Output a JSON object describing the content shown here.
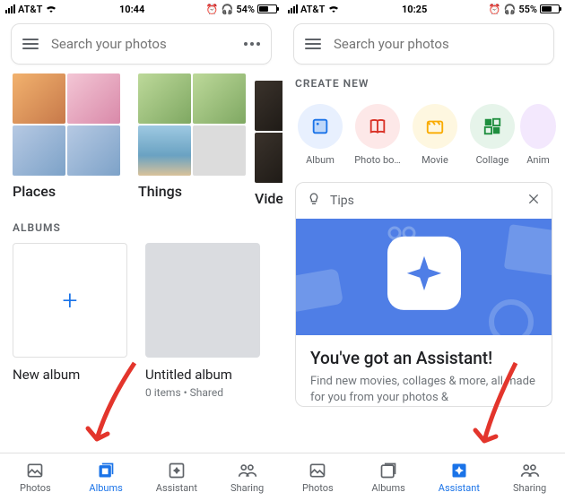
{
  "left": {
    "status": {
      "carrier": "AT&T",
      "time": "10:44",
      "battery_pct": "54%"
    },
    "search": {
      "placeholder": "Search your photos"
    },
    "categories": [
      {
        "label": "Places"
      },
      {
        "label": "Things"
      },
      {
        "label": "Videos"
      }
    ],
    "albums_header": "ALBUMS",
    "albums": [
      {
        "title": "New album",
        "sub": ""
      },
      {
        "title": "Untitled album",
        "sub": "0 items  •  Shared"
      }
    ],
    "nav": {
      "photos": "Photos",
      "albums": "Albums",
      "assistant": "Assistant",
      "sharing": "Sharing",
      "active": "albums"
    }
  },
  "right": {
    "status": {
      "carrier": "AT&T",
      "time": "10:25",
      "battery_pct": "55%"
    },
    "search": {
      "placeholder": "Search your photos"
    },
    "create_header": "CREATE NEW",
    "create": [
      {
        "label": "Album",
        "icon": "album-icon",
        "bg": "#e8f0fe",
        "fg": "#1a73e8"
      },
      {
        "label": "Photo bo…",
        "icon": "book-icon",
        "bg": "#fde8e8",
        "fg": "#d93025"
      },
      {
        "label": "Movie",
        "icon": "movie-icon",
        "bg": "#fef7e0",
        "fg": "#f9ab00"
      },
      {
        "label": "Collage",
        "icon": "collage-icon",
        "bg": "#e6f4ea",
        "fg": "#1e8e3e"
      },
      {
        "label": "Anim",
        "icon": "anim-icon",
        "bg": "#f3e8fd",
        "fg": "#9334e6"
      }
    ],
    "tips": {
      "label": "Tips",
      "title": "You've got an Assistant!",
      "body": "Find new movies, collages & more, all made for you from your photos &"
    },
    "nav": {
      "photos": "Photos",
      "albums": "Albums",
      "assistant": "Assistant",
      "sharing": "Sharing",
      "active": "assistant"
    }
  },
  "colors": {
    "accent": "#1a73e8",
    "arrow": "#e3352c"
  }
}
